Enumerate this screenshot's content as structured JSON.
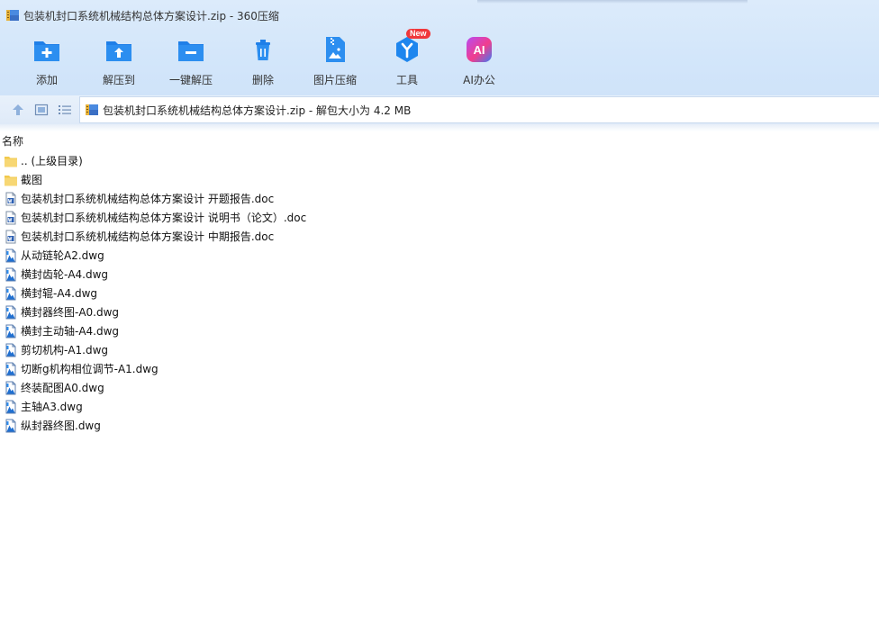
{
  "window": {
    "title": "包装机封口系统机械结构总体方案设计.zip - 360压缩"
  },
  "toolbar": {
    "add_label": "添加",
    "extract_to_label": "解压到",
    "one_click_extract_label": "一键解压",
    "delete_label": "删除",
    "image_compress_label": "图片压缩",
    "tools_label": "工具",
    "tools_badge": "New",
    "ai_office_label": "AI办公",
    "ai_icon_text": "AI"
  },
  "address": {
    "text": "包装机封口系统机械结构总体方案设计.zip - 解包大小为 4.2 MB"
  },
  "list": {
    "column_name": "名称",
    "files": [
      {
        "name": ".. (上级目录)",
        "icon": "folder-icon"
      },
      {
        "name": "截图",
        "icon": "folder-icon"
      },
      {
        "name": "包装机封口系统机械结构总体方案设计 开题报告.doc",
        "icon": "word-doc-icon"
      },
      {
        "name": "包装机封口系统机械结构总体方案设计 说明书（论文）.doc",
        "icon": "word-doc-icon"
      },
      {
        "name": "包装机封口系统机械结构总体方案设计 中期报告.doc",
        "icon": "word-doc-icon"
      },
      {
        "name": "从动链轮A2.dwg",
        "icon": "dwg-file-icon"
      },
      {
        "name": "横封齿轮-A4.dwg",
        "icon": "dwg-file-icon"
      },
      {
        "name": "横封辊-A4.dwg",
        "icon": "dwg-file-icon"
      },
      {
        "name": "横封器终图-A0.dwg",
        "icon": "dwg-file-icon"
      },
      {
        "name": "横封主动轴-A4.dwg",
        "icon": "dwg-file-icon"
      },
      {
        "name": "剪切机构-A1.dwg",
        "icon": "dwg-file-icon"
      },
      {
        "name": "切断g机构相位调节-A1.dwg",
        "icon": "dwg-file-icon"
      },
      {
        "name": "终装配图A0.dwg",
        "icon": "dwg-file-icon"
      },
      {
        "name": "主轴A3.dwg",
        "icon": "dwg-file-icon"
      },
      {
        "name": "纵封器终图.dwg",
        "icon": "dwg-file-icon"
      }
    ]
  },
  "colors": {
    "accent": "#2c8ef0",
    "toolbar_bg": "#d5e7fa",
    "folder": "#f7d774"
  }
}
